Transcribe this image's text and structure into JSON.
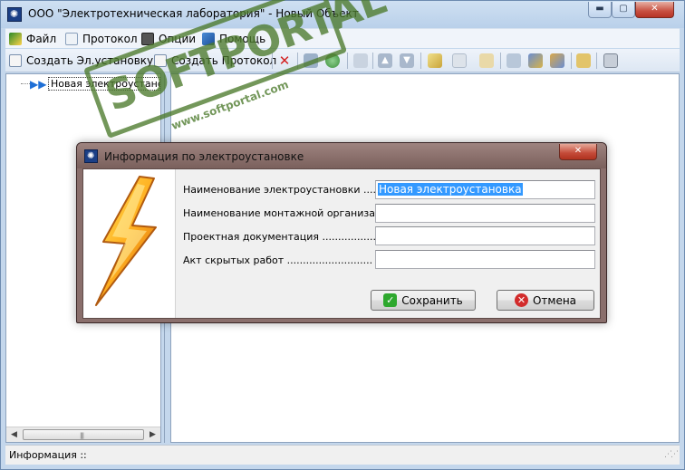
{
  "window": {
    "title": "ООО \"Электротехническая лаборатория\" - Новый Объект",
    "controls": {
      "minimize": "▬",
      "maximize": "▢",
      "close": "✕"
    }
  },
  "menu": {
    "items": [
      {
        "label": "Файл",
        "icon": "file-icon"
      },
      {
        "label": "Протокол",
        "icon": "document-icon"
      },
      {
        "label": "Опции",
        "icon": "camera-icon"
      },
      {
        "label": "Помощь",
        "icon": "help-icon"
      }
    ]
  },
  "toolbar": {
    "create_installation": "Создать  Эл.установку",
    "create_protocol": "Создать  Протокол"
  },
  "tree": {
    "node_label": "Новая электроустановк",
    "scroll_grip": "|||"
  },
  "watermark": {
    "text": "SOFTPORTAL",
    "url": "www.softportal.com"
  },
  "dialog": {
    "title": "Информация по электроустановке",
    "close": "✕",
    "fields": [
      {
        "label": "Наименование электроустановки ........",
        "value": "Новая электроустановка"
      },
      {
        "label": "Наименование монтажной организации .",
        "value": ""
      },
      {
        "label": "Проектная документация ..................",
        "value": ""
      },
      {
        "label": "Акт скрытых работ ...........................",
        "value": ""
      }
    ],
    "save_label": "Сохранить",
    "cancel_label": "Отмена"
  },
  "status": {
    "text": "Информация ::"
  },
  "colors": {
    "window_frame": "#c4d7ec",
    "dialog_frame": "#8a6f6c",
    "selection": "#3399ff",
    "watermark": "#4c7a2c"
  }
}
